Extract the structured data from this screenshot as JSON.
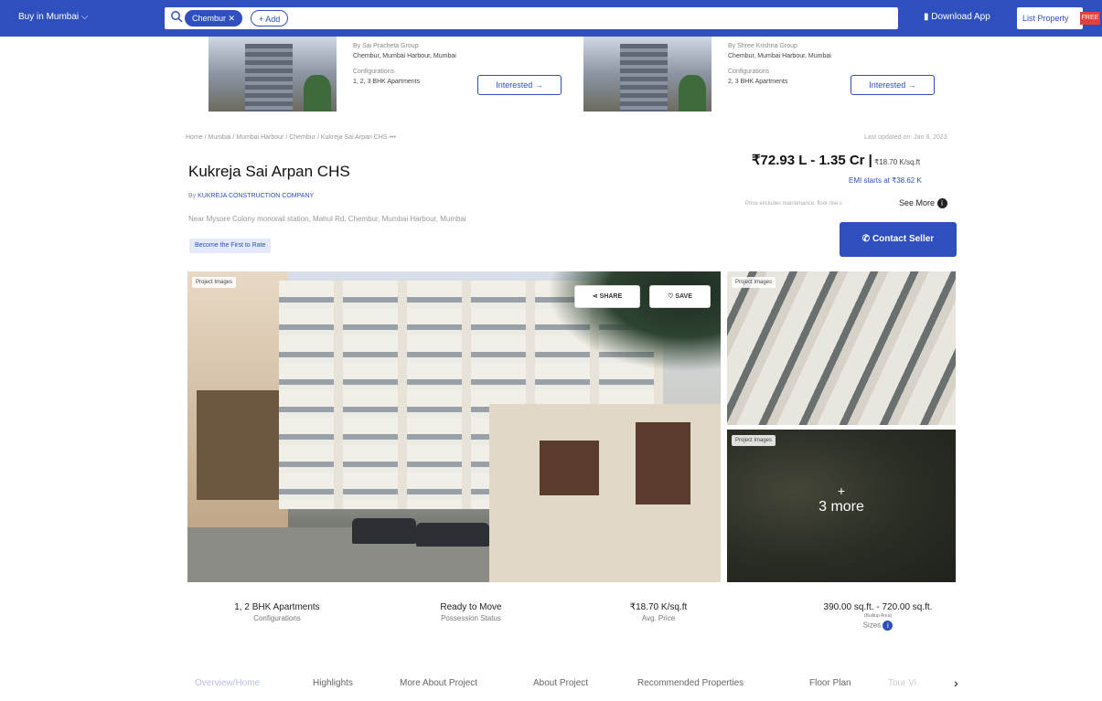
{
  "topbar": {
    "city_label": "Buy in Mumbai",
    "chip_active": "Chembur",
    "chip_add": "+ Add",
    "download_app": "Download App",
    "list_property": "List Property",
    "free_badge": "FREE"
  },
  "similar": [
    {
      "builder": "By Sai Pracheta Group",
      "location": "Chembur, Mumbai Harbour, Mumbai",
      "config_label": "Configurations",
      "config": "1, 2, 3 BHK Apartments",
      "interested": "Interested →"
    },
    {
      "builder": "By Shree Krishna Group",
      "location": "Chembur, Mumbai Harbour, Mumbai",
      "config_label": "Configurations",
      "config": "2, 3 BHK Apartments",
      "interested": "Interested →"
    }
  ],
  "breadcrumb": "Home / Mumbai / Mumbai Harbour / Chembur / Kukreja Sai Arpan CHS",
  "updated": "Last updated on: Jan 8, 2023",
  "project": {
    "title": "Kukreja Sai Arpan CHS",
    "price": "₹72.93 L - 1.35 Cr |",
    "price_sqft": " ₹18.70 K/sq.ft",
    "emi": "EMI starts at ₹38.62 K",
    "builder_prefix": "By ",
    "builder": "KUKREJA CONSTRUCTION COMPANY",
    "address": "Near Mysore Colony monorail station, Mahul Rd, Chembur, Mumbai Harbour, Mumbai",
    "excludes": "Price excludes maintenance, floor rise c",
    "see_more": "See More",
    "rera": "Become the First to Rate",
    "contact": "Contact Seller"
  },
  "gallery": {
    "tag": "Project Images",
    "share": "SHARE",
    "save": "SAVE",
    "more_plus": "+",
    "more": "3 more"
  },
  "stats": [
    {
      "value": "1, 2 BHK Apartments",
      "label": "Configurations"
    },
    {
      "value": "Ready to Move",
      "label": "Possession Status"
    },
    {
      "value": "₹18.70 K/sq.ft",
      "label": "Avg. Price"
    },
    {
      "value": "390.00 sq.ft. - 720.00 sq.ft.",
      "sub": "(Builtup Area)",
      "label": "Sizes"
    }
  ],
  "tabs": [
    "Overview/Home",
    "Highlights",
    "More About Project",
    "About Project",
    "Recommended Properties",
    "Floor Plan",
    "Tour Vi"
  ],
  "colors": {
    "brand": "#2e4fbd",
    "badge": "#e53e3e"
  }
}
